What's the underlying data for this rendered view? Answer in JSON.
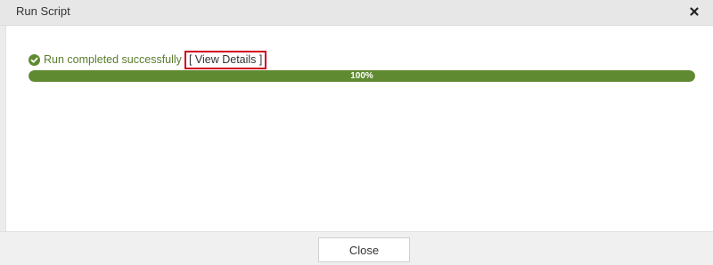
{
  "dialog": {
    "title": "Run Script"
  },
  "status": {
    "message": "Run completed successfully",
    "details_link": "[ View Details ]",
    "icon": "check-circle-icon"
  },
  "progress": {
    "value": 100,
    "label": "100%"
  },
  "footer": {
    "close_label": "Close"
  },
  "colors": {
    "success_text": "#5a7d2e",
    "progress_fill": "#5f8a32",
    "highlight_border": "#d0021b"
  }
}
